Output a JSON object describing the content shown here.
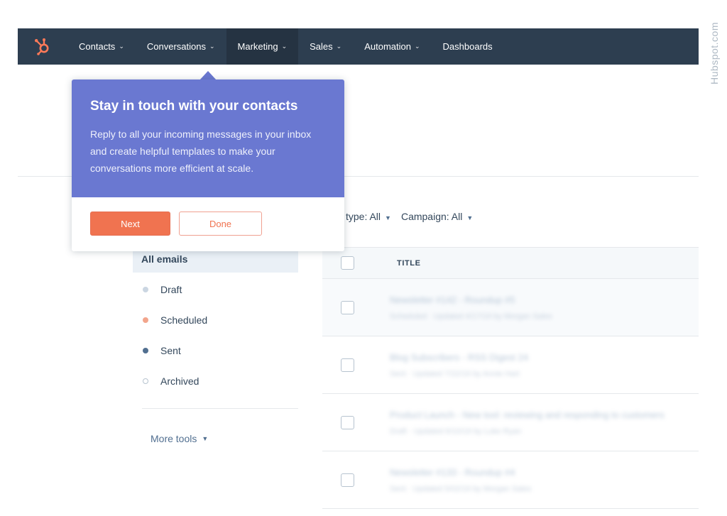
{
  "brand": {
    "accent": "#ff7a59",
    "nav_bg": "#2d3e50",
    "popover_bg": "#6a78d1"
  },
  "watermark": "Hubspot.com",
  "nav": {
    "logo_icon": "hubspot-sprocket-icon",
    "items": [
      {
        "label": "Contacts",
        "has_dropdown": true
      },
      {
        "label": "Conversations",
        "has_dropdown": true
      },
      {
        "label": "Marketing",
        "has_dropdown": true
      },
      {
        "label": "Sales",
        "has_dropdown": true
      },
      {
        "label": "Automation",
        "has_dropdown": true
      },
      {
        "label": "Dashboards",
        "has_dropdown": false
      }
    ]
  },
  "popover": {
    "title": "Stay in touch with your contacts",
    "body": "Reply to all your incoming messages in your inbox and create helpful templates to make your conversations more efficient at scale.",
    "next_label": "Next",
    "done_label": "Done"
  },
  "filters": {
    "type_label": "l type: All",
    "campaign_label": "Campaign: All"
  },
  "sidebar": {
    "active_label": "All emails",
    "statuses": [
      {
        "label": "Draft",
        "color": "#cbd6e2",
        "hollow": false
      },
      {
        "label": "Scheduled",
        "color": "#f2a58c",
        "hollow": false
      },
      {
        "label": "Sent",
        "color": "#516f90",
        "hollow": false
      },
      {
        "label": "Archived",
        "color": "#ffffff",
        "hollow": true
      }
    ],
    "more_tools_label": "More tools"
  },
  "table": {
    "header_title": "TITLE",
    "rows": [
      {
        "title": "Newsletter #142 - Roundup #5",
        "meta": "Scheduled · Updated 4/17/19 by Morgan Sales"
      },
      {
        "title": "Blog Subscribers - RSS Digest 24",
        "meta": "Sent · Updated 7/22/19 by Annie Hart"
      },
      {
        "title": "Product Launch - New tool: reviewing and responding to customers",
        "meta": "Draft · Updated 6/10/19 by Luke Ryan"
      },
      {
        "title": "Newsletter #133 - Roundup #4",
        "meta": "Sent · Updated 5/02/19 by Morgan Sales"
      }
    ]
  }
}
